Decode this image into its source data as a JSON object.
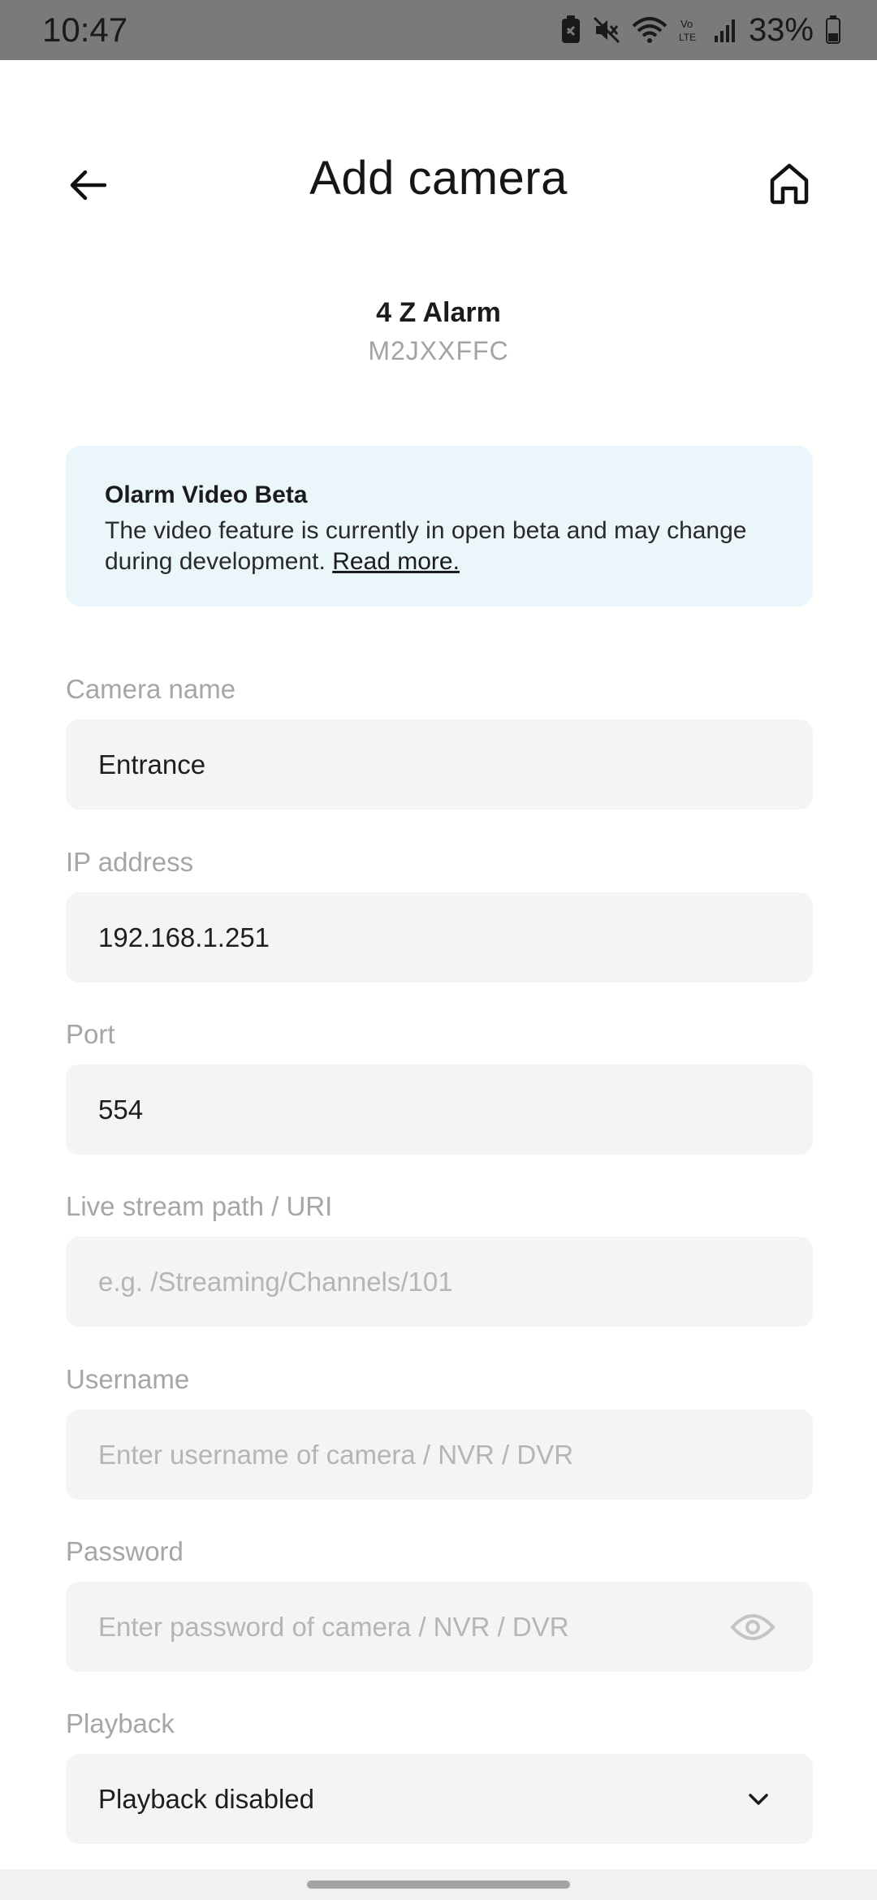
{
  "status_bar": {
    "time": "10:47",
    "battery": "33%",
    "icons": [
      "battery-saver-icon",
      "mute-icon",
      "wifi-icon",
      "volte-icon",
      "signal-icon",
      "battery-icon"
    ]
  },
  "header": {
    "title": "Add camera",
    "back_icon": "arrow-left-icon",
    "home_icon": "home-icon"
  },
  "device": {
    "name": "4 Z Alarm",
    "id": "M2JXXFFC"
  },
  "beta_notice": {
    "title": "Olarm Video Beta",
    "text": "The video feature is currently in open beta and may change during development.",
    "link": "Read more."
  },
  "form": {
    "camera_name": {
      "label": "Camera name",
      "value": "Entrance"
    },
    "ip_address": {
      "label": "IP address",
      "value": "192.168.1.251"
    },
    "port": {
      "label": "Port",
      "value": "554"
    },
    "stream_path": {
      "label": "Live stream path / URI",
      "placeholder": "e.g. /Streaming/Channels/101"
    },
    "username": {
      "label": "Username",
      "placeholder": "Enter username of camera / NVR / DVR"
    },
    "password": {
      "label": "Password",
      "placeholder": "Enter password of camera / NVR / DVR",
      "icon": "eye-icon"
    },
    "playback": {
      "label": "Playback",
      "value": "Playback disabled",
      "icon": "chevron-down-icon"
    }
  }
}
